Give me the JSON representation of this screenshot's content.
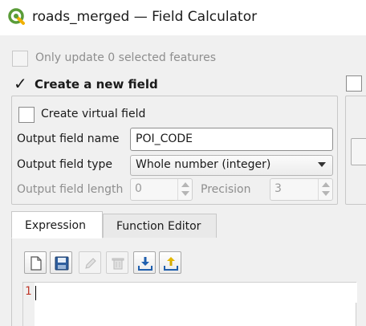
{
  "window": {
    "title": "roads_merged — Field Calculator"
  },
  "options": {
    "only_update_label": "Only update 0 selected features",
    "create_new_field_checkmark": "✓",
    "create_new_field_label": "Create a new field",
    "create_virtual_label": "Create virtual field"
  },
  "fields": {
    "output_name_label": "Output field name",
    "output_name_value": "POI_CODE",
    "output_type_label": "Output field type",
    "output_type_value": "Whole number (integer)",
    "output_length_label": "Output field length",
    "output_length_value": "0",
    "precision_label": "Precision",
    "precision_value": "3"
  },
  "tabs": [
    {
      "label": "Expression"
    },
    {
      "label": "Function Editor"
    }
  ],
  "editor": {
    "line_number": "1"
  },
  "colors": {
    "accent_blue": "#1f5fae",
    "qgis_green": "#5a9c38",
    "line_number_red": "#c0392b"
  }
}
